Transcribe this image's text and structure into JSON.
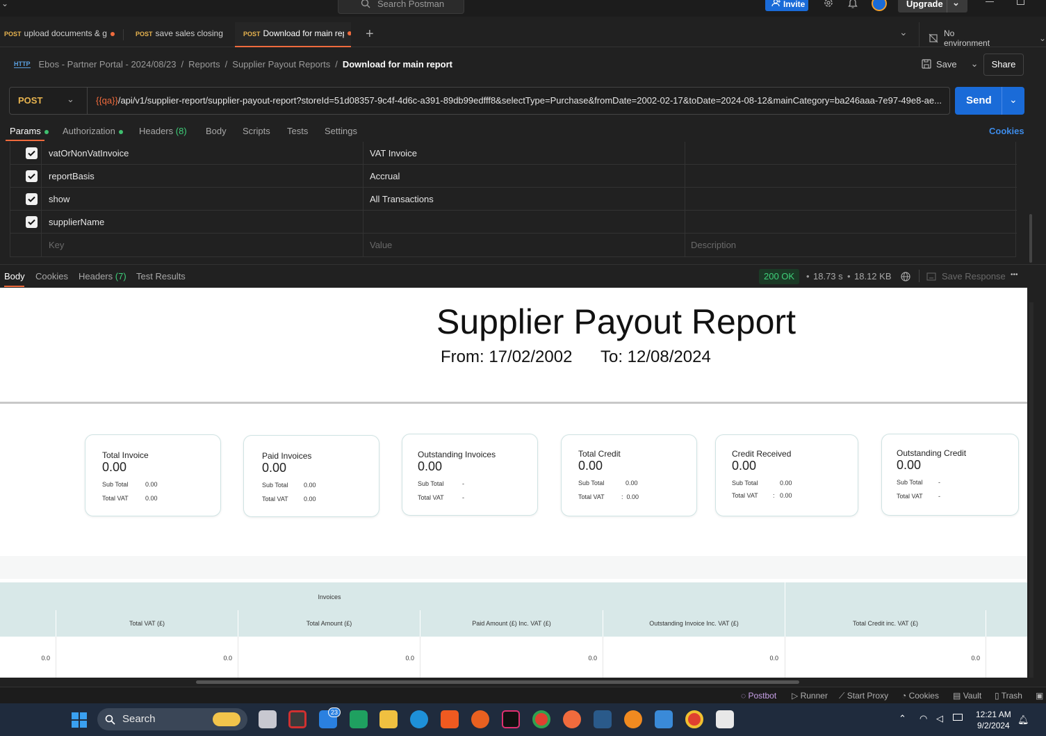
{
  "topbar": {
    "search_placeholder": "Search Postman",
    "invite_label": "Invite",
    "upgrade_label": "Upgrade"
  },
  "tabs": [
    {
      "method": "POST",
      "label": "upload documents & g"
    },
    {
      "method": "POST",
      "label": "save sales closing"
    },
    {
      "method": "POST",
      "label": "Download for main rep"
    }
  ],
  "environment": {
    "label": "No environment"
  },
  "breadcrumb": {
    "items": [
      "Ebos - Partner Portal - 2024/08/23",
      "Reports",
      "Supplier Payout Reports"
    ],
    "current": "Download for main report",
    "separator": "/"
  },
  "request_actions": {
    "save_label": "Save",
    "share_label": "Share"
  },
  "request": {
    "method": "POST",
    "url_var": "{{qa}}",
    "url_rest": "/api/v1/supplier-report/supplier-payout-report?storeId=51d08357-9c4f-4d6c-a391-89db99edfff8&selectType=Purchase&fromDate=2002-02-17&toDate=2024-08-12&mainCategory=ba246aaa-7e97-49e8-ae...",
    "send_label": "Send"
  },
  "request_tabs": {
    "params": "Params",
    "authorization": "Authorization",
    "headers": "Headers",
    "headers_count": "(8)",
    "body": "Body",
    "scripts": "Scripts",
    "tests": "Tests",
    "settings": "Settings",
    "cookies": "Cookies"
  },
  "params": {
    "rows": [
      {
        "key": "vatOrNonVatInvoice",
        "value": "VAT Invoice"
      },
      {
        "key": "reportBasis",
        "value": "Accrual"
      },
      {
        "key": "show",
        "value": "All Transactions"
      },
      {
        "key": "supplierName",
        "value": ""
      }
    ],
    "placeholder_key": "Key",
    "placeholder_value": "Value",
    "placeholder_description": "Description"
  },
  "response": {
    "tabs": {
      "body": "Body",
      "cookies": "Cookies",
      "headers": "Headers",
      "headers_count": "(7)",
      "test_results": "Test Results"
    },
    "status": "200 OK",
    "time": "18.73 s",
    "size": "18.12 KB",
    "save_response": "Save Response",
    "more": "•••"
  },
  "report": {
    "title": "Supplier Payout Report",
    "from": "From: 17/02/2002",
    "to": "To: 12/08/2024",
    "cards": [
      {
        "title": "Total Invoice",
        "value": "0.00",
        "sub_label": "Sub Total",
        "sub_value": "0.00",
        "vat_label": "Total VAT",
        "vat_value": "0.00"
      },
      {
        "title": "Paid Invoices",
        "value": "0.00",
        "sub_label": "Sub Total",
        "sub_value": "0.00",
        "vat_label": "Total VAT",
        "vat_value": "0.00"
      },
      {
        "title": "Outstanding Invoices",
        "value": "0.00",
        "sub_label": "Sub Total",
        "sub_value": "-",
        "vat_label": "Total VAT",
        "vat_value": "-"
      },
      {
        "title": "Total Credit",
        "value": "0.00",
        "sub_label": "Sub Total",
        "sub_value": "0.00",
        "vat_label": "Total VAT",
        "vat_value": ":  0.00"
      },
      {
        "title": "Credit Received",
        "value": "0.00",
        "sub_label": "Sub Total",
        "sub_value": "0.00",
        "vat_label": "Total VAT",
        "vat_value": ":   0.00"
      },
      {
        "title": "Outstanding Credit",
        "value": "0.00",
        "sub_label": "Sub Total",
        "sub_value": "-",
        "vat_label": "Total VAT",
        "vat_value": "-"
      }
    ],
    "table": {
      "group_header": "Invoices",
      "columns": [
        "Total VAT (£)",
        "Total Amount (£)",
        "Paid Amount (£) Inc. VAT (£)",
        "Outstanding Invoice Inc. VAT (£)",
        "Total Credit inc. VAT (£)"
      ],
      "row": [
        "0.0",
        "0.0",
        "0.0",
        "0.0",
        "0.0",
        "0.0"
      ]
    }
  },
  "statusbar": {
    "postbot": "Postbot",
    "runner": "Runner",
    "start_proxy": "Start Proxy",
    "cookies": "Cookies",
    "vault": "Vault",
    "trash": "Trash"
  },
  "taskbar": {
    "search_label": "Search",
    "mail_badge": "23",
    "time": "12:21 AM",
    "date": "9/2/2024"
  }
}
